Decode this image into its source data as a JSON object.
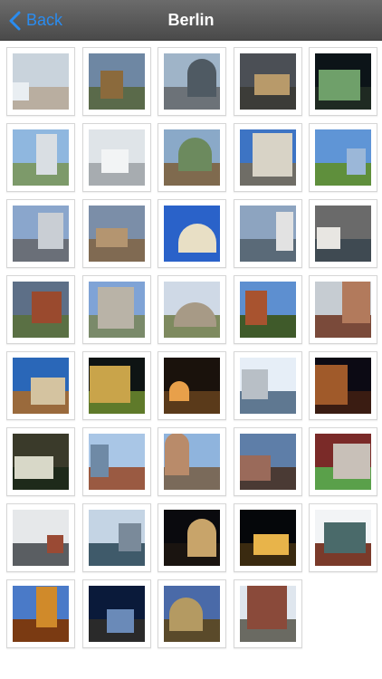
{
  "nav": {
    "back_label": "Back",
    "title": "Berlin"
  },
  "photos": [
    {
      "name": "photo-1",
      "sky": "#c9d3dc",
      "ground": "#b9aea0",
      "mass": "#e9eef2"
    },
    {
      "name": "photo-2",
      "sky": "#6e87a3",
      "ground": "#5a6a4a",
      "mass": "#8b6a3c"
    },
    {
      "name": "photo-3",
      "sky": "#9fb4c8",
      "ground": "#6c7278",
      "mass": "#4f5a63"
    },
    {
      "name": "photo-4",
      "sky": "#4b4f55",
      "ground": "#3c3c38",
      "mass": "#b89a6a"
    },
    {
      "name": "photo-5",
      "sky": "#0c1418",
      "ground": "#1f2a22",
      "mass": "#6fa06a"
    },
    {
      "name": "photo-6",
      "sky": "#8fb7df",
      "ground": "#7d9a6a",
      "mass": "#d9dee3"
    },
    {
      "name": "photo-7",
      "sky": "#dfe4e8",
      "ground": "#a7acb0",
      "mass": "#f2f4f5"
    },
    {
      "name": "photo-8",
      "sky": "#8aa9c8",
      "ground": "#7f6a4e",
      "mass": "#6c8a5e"
    },
    {
      "name": "photo-9",
      "sky": "#3d74c4",
      "ground": "#6f6d66",
      "mass": "#d8d3c6"
    },
    {
      "name": "photo-10",
      "sky": "#5f95d6",
      "ground": "#5f8f3c",
      "mass": "#9bb7d8"
    },
    {
      "name": "photo-11",
      "sky": "#8aa6cc",
      "ground": "#6a6f78",
      "mass": "#c9ced4"
    },
    {
      "name": "photo-12",
      "sky": "#7b8ea8",
      "ground": "#806a52",
      "mass": "#b49570"
    },
    {
      "name": "photo-13",
      "sky": "#2a62c9",
      "ground": "#2a62c9",
      "mass": "#e8dfc5"
    },
    {
      "name": "photo-14",
      "sky": "#8da4c0",
      "ground": "#5a6a78",
      "mass": "#e2e2e2"
    },
    {
      "name": "photo-15",
      "sky": "#6a6a6a",
      "ground": "#3f4a52",
      "mass": "#e8e6e2"
    },
    {
      "name": "photo-16",
      "sky": "#5d6f87",
      "ground": "#5a7044",
      "mass": "#9a4a2e"
    },
    {
      "name": "photo-17",
      "sky": "#7fa3d6",
      "ground": "#7a8a6a",
      "mass": "#b9b3a7"
    },
    {
      "name": "photo-18",
      "sky": "#cfd9e6",
      "ground": "#7e8a5f",
      "mass": "#a79a86"
    },
    {
      "name": "photo-19",
      "sky": "#5d8fd0",
      "ground": "#3f5a2a",
      "mass": "#a8532f"
    },
    {
      "name": "photo-20",
      "sky": "#c6ccd2",
      "ground": "#7a4a3a",
      "mass": "#b27a5c"
    },
    {
      "name": "photo-21",
      "sky": "#2a67b8",
      "ground": "#9a6a3c",
      "mass": "#d4c3a0"
    },
    {
      "name": "photo-22",
      "sky": "#0e1414",
      "ground": "#5f7a2a",
      "mass": "#c9a44a"
    },
    {
      "name": "photo-23",
      "sky": "#1a120c",
      "ground": "#5a3a1a",
      "mass": "#e8a04a"
    },
    {
      "name": "photo-24",
      "sky": "#e6eef7",
      "ground": "#5f7891",
      "mass": "#b8bfc6"
    },
    {
      "name": "photo-25",
      "sky": "#0c0a14",
      "ground": "#3a1c12",
      "mass": "#a05a2a"
    },
    {
      "name": "photo-26",
      "sky": "#3a3a2a",
      "ground": "#1e2a1a",
      "mass": "#d8d8c8"
    },
    {
      "name": "photo-27",
      "sky": "#a9c6e6",
      "ground": "#9a5a42",
      "mass": "#6f8aa6"
    },
    {
      "name": "photo-28",
      "sky": "#8fb4dd",
      "ground": "#7a6a5a",
      "mass": "#b98b6a"
    },
    {
      "name": "photo-29",
      "sky": "#5e7ea8",
      "ground": "#4a3a34",
      "mass": "#9a6a5a"
    },
    {
      "name": "photo-30",
      "sky": "#7a2a28",
      "ground": "#5aa04a",
      "mass": "#c8c0b8"
    },
    {
      "name": "photo-31",
      "sky": "#e6e8ea",
      "ground": "#5a5e62",
      "mass": "#9a4a34"
    },
    {
      "name": "photo-32",
      "sky": "#c4d4e4",
      "ground": "#3f5a6a",
      "mass": "#7a8a9a"
    },
    {
      "name": "photo-33",
      "sky": "#0a0a0e",
      "ground": "#1a1410",
      "mass": "#c8a46a"
    },
    {
      "name": "photo-34",
      "sky": "#05070a",
      "ground": "#3a2a10",
      "mass": "#e8b44a"
    },
    {
      "name": "photo-35",
      "sky": "#f2f4f6",
      "ground": "#7a3a2a",
      "mass": "#4a6a6a"
    },
    {
      "name": "photo-36",
      "sky": "#4a7ac8",
      "ground": "#7a3a12",
      "mass": "#d08a2a"
    },
    {
      "name": "photo-37",
      "sky": "#0a1a3a",
      "ground": "#2a2a2a",
      "mass": "#6a8ab8"
    },
    {
      "name": "photo-38",
      "sky": "#4a6aa8",
      "ground": "#5a4a2a",
      "mass": "#b49a62"
    },
    {
      "name": "photo-39",
      "sky": "#dfe6ee",
      "ground": "#6a6a62",
      "mass": "#8a4a3a"
    }
  ]
}
